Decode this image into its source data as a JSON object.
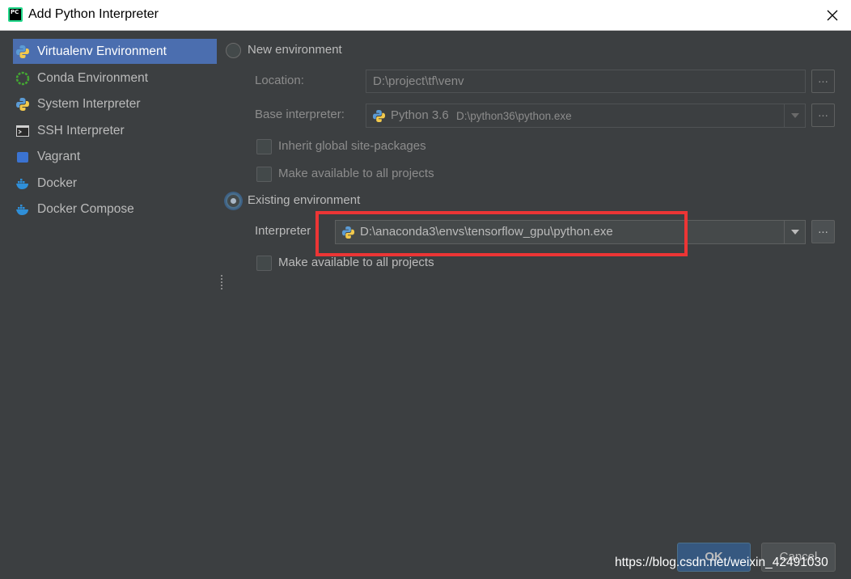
{
  "window": {
    "title": "Add Python Interpreter",
    "app_icon_text": "PC"
  },
  "sidebar": {
    "items": [
      {
        "label": "Virtualenv Environment",
        "icon": "python-icon",
        "selected": true
      },
      {
        "label": "Conda Environment",
        "icon": "conda-icon",
        "selected": false
      },
      {
        "label": "System Interpreter",
        "icon": "python-icon",
        "selected": false
      },
      {
        "label": "SSH Interpreter",
        "icon": "terminal-icon",
        "selected": false
      },
      {
        "label": "Vagrant",
        "icon": "vagrant-icon",
        "selected": false
      },
      {
        "label": "Docker",
        "icon": "docker-icon",
        "selected": false
      },
      {
        "label": "Docker Compose",
        "icon": "docker-icon",
        "selected": false
      }
    ]
  },
  "new_env": {
    "label": "New environment",
    "location_label": "Location:",
    "location_value": "D:\\project\\tf\\venv",
    "base_label": "Base interpreter:",
    "base_version": "Python 3.6",
    "base_path": "D:\\python36\\python.exe",
    "inherit_label": "Inherit global site-packages",
    "make_available_label": "Make available to all projects",
    "browse": "..."
  },
  "existing_env": {
    "label": "Existing environment",
    "interpreter_label": "Interpreter",
    "interpreter_value": "D:\\anaconda3\\envs\\tensorflow_gpu\\python.exe",
    "make_available_label": "Make available to all projects",
    "browse": "..."
  },
  "buttons": {
    "ok": "OK",
    "cancel": "Cancel"
  },
  "watermark": "https://blog.csdn.net/weixin_42491030",
  "colors": {
    "accent": "#4b6eaf",
    "highlight": "#ec3535",
    "background": "#3c3f41"
  }
}
